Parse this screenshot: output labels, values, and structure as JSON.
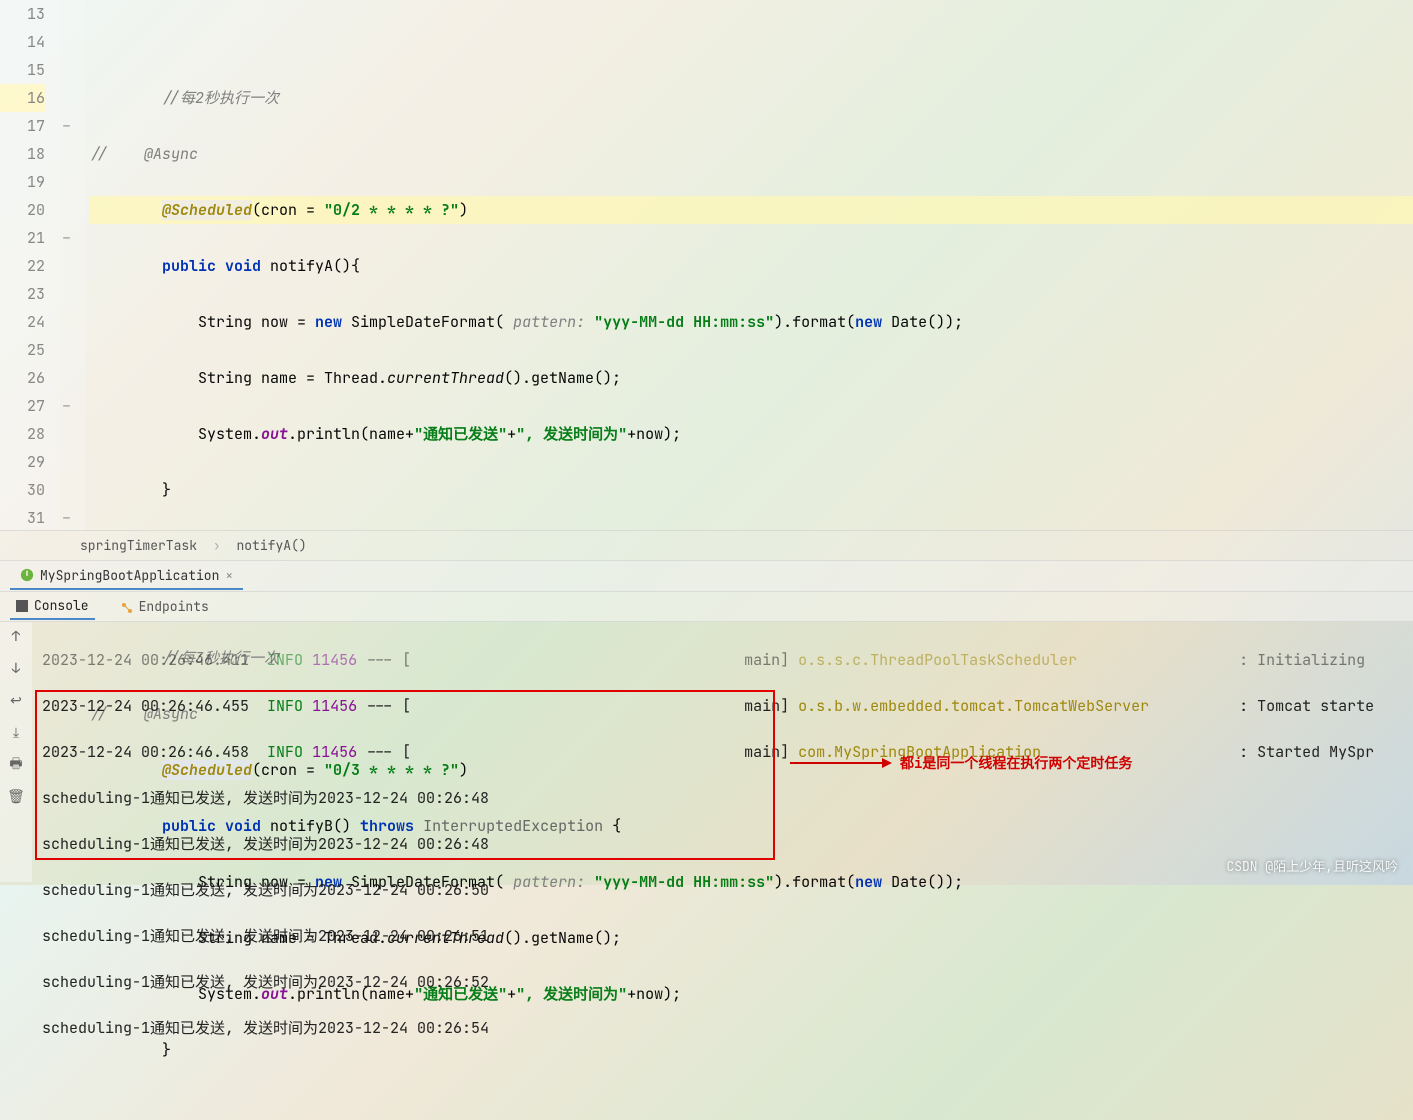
{
  "gutter": [
    "13",
    "14",
    "15",
    "16",
    "17",
    "18",
    "19",
    "20",
    "21",
    "22",
    "23",
    "24",
    "25",
    "26",
    "27",
    "28",
    "29",
    "30",
    "31"
  ],
  "highlight_line_idx": 3,
  "code": {
    "l13": "",
    "l14_comment": "//每2秒执行一次",
    "l15_prefix": "//    ",
    "l15_anno": "@Async",
    "l16_anno": "@Scheduled",
    "l16_mid": "(cron = ",
    "l16_str": "\"0/2 * * * * ?\"",
    "l16_end": ")",
    "l17_kw1": "public void ",
    "l17_name": "notifyA(){",
    "l18_pre": "String now = ",
    "l18_new": "new ",
    "l18_cls": "SimpleDateFormat( ",
    "l18_param": "pattern: ",
    "l18_str": "\"yyy-MM-dd HH:mm:ss\"",
    "l18_mid": ").format(",
    "l18_new2": "new ",
    "l18_end": "Date());",
    "l19": "String name = Thread.",
    "l19_it": "currentThread",
    "l19_end": "().getName();",
    "l20_pre": "System.",
    "l20_out": "out",
    "l20_mid": ".println(name+",
    "l20_str1": "\"通知已发送\"",
    "l20_plus": "+",
    "l20_str2": "\", 发送时间为\"",
    "l20_end": "+now);",
    "l21": "}",
    "l24_comment": "//每3秒执行一次",
    "l25_prefix": "//    ",
    "l25_anno": "@Async",
    "l26_anno": "@Scheduled",
    "l26_mid": "(cron = ",
    "l26_str": "\"0/3 * * * * ?\"",
    "l26_end": ")",
    "l27_kw1": "public void ",
    "l27_name": "notifyB() ",
    "l27_kw2": "throws ",
    "l27_exc": "InterruptedException ",
    "l27_end": "{",
    "l28_pre": "String now = ",
    "l28_new": "new ",
    "l28_cls": "SimpleDateFormat( ",
    "l28_param": "pattern: ",
    "l28_str": "\"yyy-MM-dd HH:mm:ss\"",
    "l28_mid": ").format(",
    "l28_new2": "new ",
    "l28_end": "Date());",
    "l29": "String name = Thread.",
    "l29_it": "currentThread",
    "l29_end": "().getName();",
    "l30_pre": "System.",
    "l30_out": "out",
    "l30_mid": ".println(name+",
    "l30_str1": "\"通知已发送\"",
    "l30_plus": "+",
    "l30_str2": "\", 发送时间为\"",
    "l30_end": "+now);",
    "l31": "}"
  },
  "breadcrumb": {
    "cls": "springTimerTask",
    "method": "notifyA()"
  },
  "run_tab": {
    "name": "MySpringBootApplication"
  },
  "tool_tabs": {
    "console": "Console",
    "endpoints": "Endpoints"
  },
  "console": {
    "r1_ts": "2023-12-24 00:26:46.411",
    "r1_info": "INFO",
    "r1_pid": "11456",
    "r1_dash": " --- [",
    "r1_thread": "           main] ",
    "r1_logger": "o.s.s.c.ThreadPoolTaskScheduler",
    "r1_colon": "       : ",
    "r1_msg": "Initializing ",
    "r2_ts": "2023-12-24 00:26:46.455",
    "r2_logger": "o.s.b.w.embedded.tomcat.TomcatWebServer",
    "r2_msg": "Tomcat starte",
    "r3_ts": "2023-12-24 00:26:46.458",
    "r3_logger": "com.MySpringBootApplication",
    "r3_msg": "Started MySpr",
    "out1": "scheduling-1通知已发送, 发送时间为2023-12-24 00:26:48",
    "out2": "scheduling-1通知已发送, 发送时间为2023-12-24 00:26:48",
    "out3": "scheduling-1通知已发送, 发送时间为2023-12-24 00:26:50",
    "out4": "scheduling-1通知已发送, 发送时间为2023-12-24 00:26:51",
    "out5": "scheduling-1通知已发送, 发送时间为2023-12-24 00:26:52",
    "out6": "scheduling-1通知已发送, 发送时间为2023-12-24 00:26:54"
  },
  "annotation": "都i是同一个线程在执行两个定时任务",
  "watermark": "CSDN @陌上少年,且听这风吟"
}
